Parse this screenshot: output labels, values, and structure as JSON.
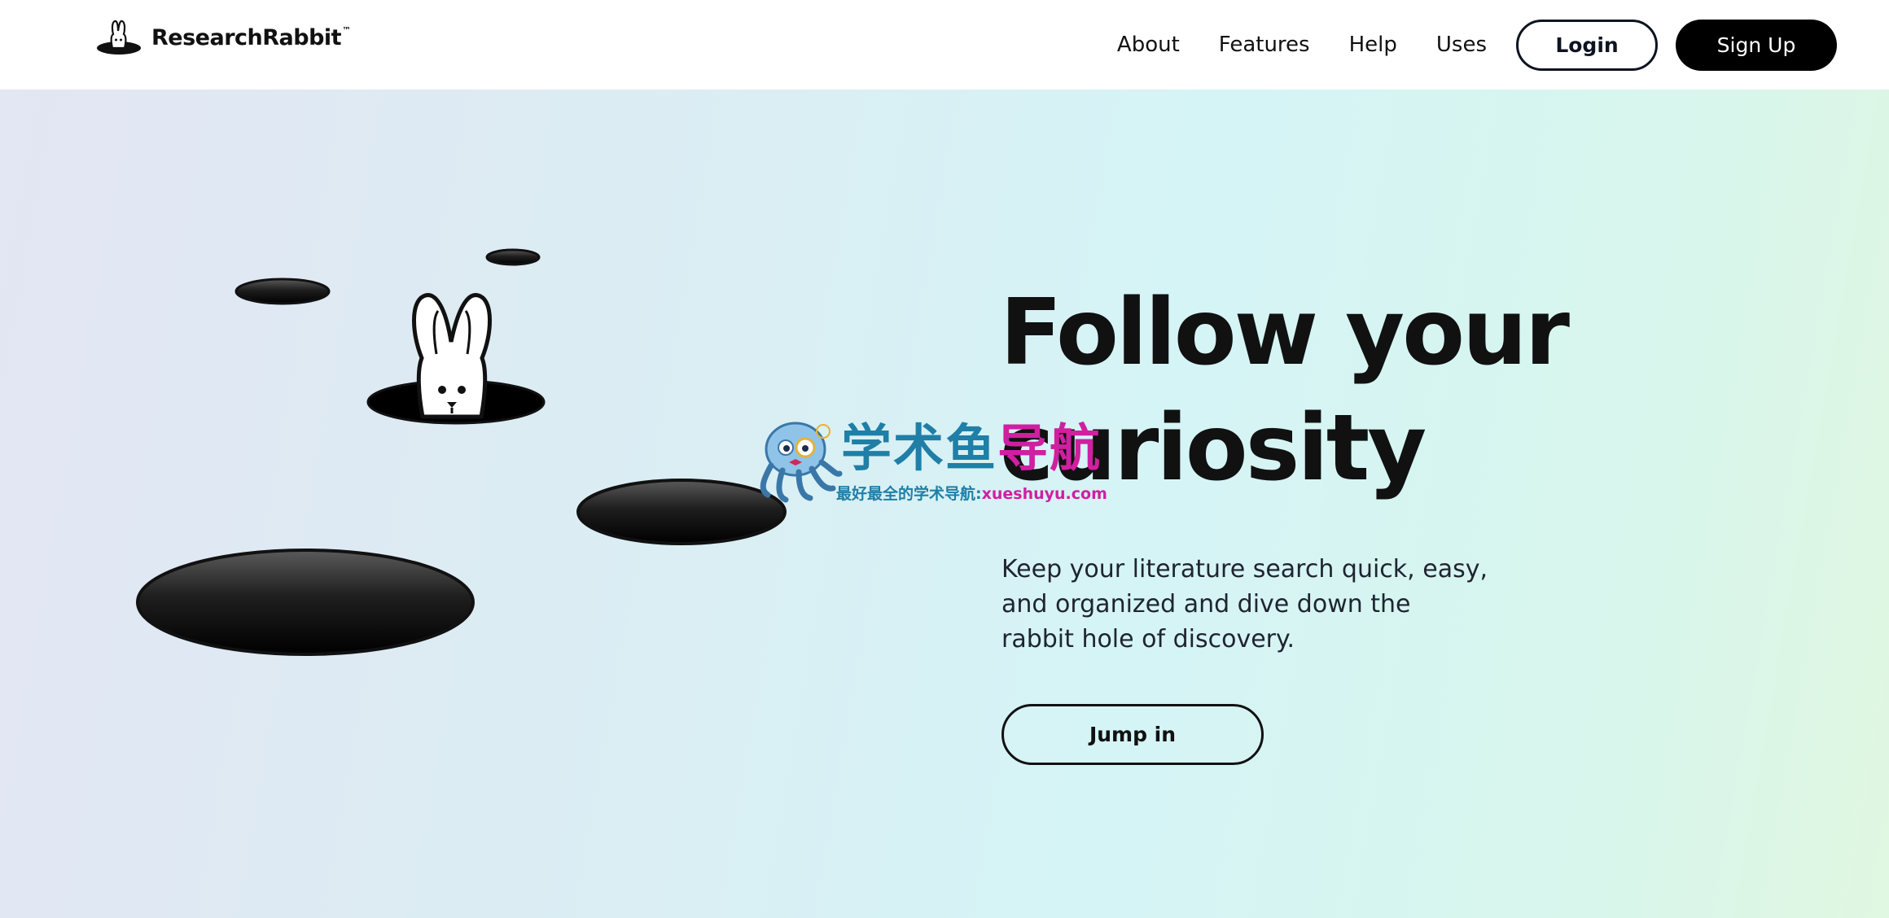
{
  "header": {
    "brand": "ResearchRabbit",
    "brand_mark": "™",
    "nav": [
      {
        "label": "About"
      },
      {
        "label": "Features"
      },
      {
        "label": "Help"
      },
      {
        "label": "Uses"
      }
    ],
    "login_label": "Login",
    "signup_label": "Sign Up"
  },
  "hero": {
    "headline_line1": "Follow your",
    "headline_line2": "curiosity",
    "subtitle": "Keep your literature search quick, easy, and organized and dive down the rabbit hole of discovery.",
    "cta_label": "Jump in"
  },
  "watermark": {
    "title_part1": "学术鱼",
    "title_part2": "导航",
    "subtitle_part1": "最好最全的学术导航:",
    "subtitle_url": "xueshuyu.com"
  },
  "colors": {
    "primary": "#000000",
    "outline": "#0d1321",
    "watermark_blue": "#1f7fa6",
    "watermark_magenta": "#d01fa1"
  },
  "icons": {
    "logo": "rabbit-in-hole-icon"
  }
}
